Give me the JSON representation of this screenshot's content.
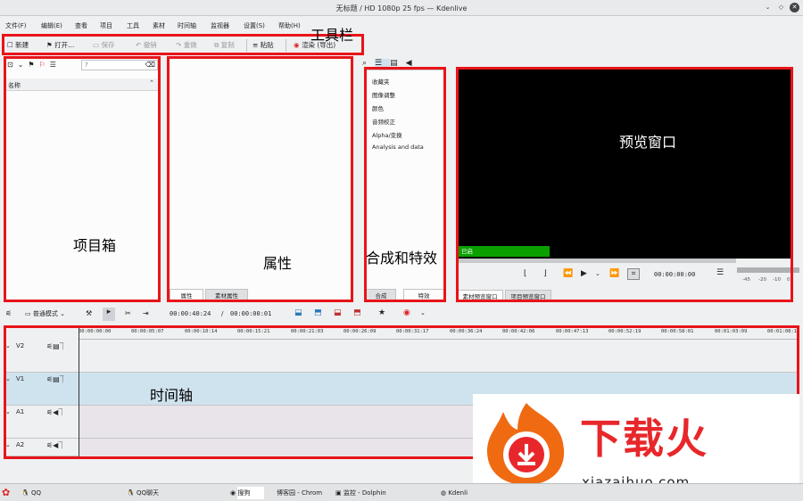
{
  "window": {
    "title": "无标题 / HD 1080p 25 fps — Kdenlive"
  },
  "menubar": [
    "文件(F)",
    "编辑(E)",
    "查看",
    "项目",
    "工具",
    "素材",
    "时间轴",
    "监视器",
    "设置(S)",
    "帮助(H)"
  ],
  "toolbar": {
    "new": "新建",
    "open": "打开...",
    "save": "保存",
    "undo": "撤销",
    "redo": "重做",
    "copy": "复制",
    "paste": "粘贴",
    "render": "渲染 (导出)"
  },
  "annotations": {
    "toolbar": "工具栏",
    "bin": "项目箱",
    "properties": "属性",
    "effects": "合成和特效",
    "monitor": "预览窗口",
    "timeline": "时间轴"
  },
  "bin": {
    "search_placeholder": "?",
    "column": "名称"
  },
  "properties_tabs": [
    "属性",
    "素材属性"
  ],
  "effects": {
    "items": [
      "收藏夹",
      "图像调整",
      "颜色",
      "音频校正",
      "Alpha/变换",
      "Analysis and data"
    ],
    "tabs": [
      "合成",
      "特效"
    ]
  },
  "monitor": {
    "clip_label": "已启",
    "timecode": "00:00:00:00",
    "tabs": [
      "素材预览窗口",
      "项目预览窗口"
    ],
    "audio_scale": [
      "-45",
      "-20",
      "-10",
      "0"
    ]
  },
  "timeline_toolbar": {
    "mode": "普通模式",
    "position": "00:00:40:24",
    "duration": "00:00:00:01"
  },
  "ruler": [
    "00:00:00:00",
    "00:00:05:07",
    "00:00:10:14",
    "00:00:15:21",
    "00:00:21:03",
    "00:00:26:09",
    "00:00:31:17",
    "00:00:36:24",
    "00:00:42:06",
    "00:00:47:13",
    "00:00:52:19",
    "00:00:58:01",
    "00:01:03:09",
    "00:01:08:1"
  ],
  "tracks": [
    "V2",
    "V1",
    "A1",
    "A2"
  ],
  "taskbar": [
    "QQ",
    "QQ聊天",
    "搜狗",
    "博客园 - Chrom",
    "监控 - Dolphin",
    "Kdenli"
  ],
  "watermark": {
    "text": "下载火",
    "url": "xiazaihuo.com"
  },
  "colors": {
    "red_box": "#e8141a",
    "monitor_bg": "#000000",
    "clip_label": "#0aa000",
    "selected_track": "#cfe3ef",
    "audio_track": "#e9e4ea"
  }
}
